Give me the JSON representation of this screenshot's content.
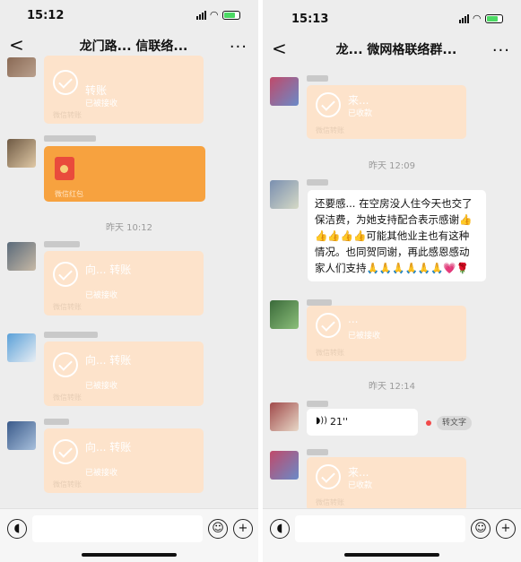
{
  "left": {
    "status": {
      "time": "15:12"
    },
    "nav": {
      "back": "<",
      "title": "龙门路... 信联络...",
      "more": "..."
    },
    "messages": [
      {
        "type": "transfer",
        "title": "转账",
        "status": "已被接收",
        "footer": "微信转账"
      },
      {
        "type": "redpacket",
        "title": "",
        "footer": "微信红包"
      },
      {
        "type": "timestamp",
        "text": "昨天 10:12"
      },
      {
        "type": "transfer",
        "title": "向... 转账",
        "status": "已被接收",
        "footer": "微信转账"
      },
      {
        "type": "transfer",
        "title": "向... 转账",
        "status": "已被接收",
        "footer": "微信转账"
      },
      {
        "type": "transfer",
        "title": "向... 转账",
        "status": "已被接收",
        "footer": "微信转账"
      }
    ]
  },
  "right": {
    "status": {
      "time": "15:13"
    },
    "nav": {
      "back": "<",
      "title": "龙... 微网格联络群...",
      "more": "..."
    },
    "messages": [
      {
        "type": "transfer",
        "title": "来...",
        "status": "已收款",
        "footer": "微信转账"
      },
      {
        "type": "timestamp",
        "text": "昨天 12:09"
      },
      {
        "type": "text",
        "text": "还要感... 在空房没人住今天也交了保洁费，为她支持配合表示感谢👍👍👍👍👍可能其他业主也有这种情况。也同贺同谢，再此感恩感动家人们支持🙏🙏🙏🙏🙏🙏💗🌹"
      },
      {
        "type": "transfer",
        "title": "...",
        "status": "已被接收",
        "footer": "微信转账"
      },
      {
        "type": "timestamp",
        "text": "昨天 12:14"
      },
      {
        "type": "voice",
        "duration": "21''",
        "to_text": "转文字"
      },
      {
        "type": "transfer",
        "title": "来...",
        "status": "已收款",
        "footer": "微信转账"
      }
    ]
  },
  "colors": {
    "transfer_bubble": "#fde3cb",
    "redpacket_bubble": "#f7a23f",
    "background": "#ededed"
  },
  "icons": [
    "back-icon",
    "more-icon",
    "voice-input-icon",
    "emoji-icon",
    "add-icon",
    "check-circle-icon",
    "red-envelope-icon",
    "voice-wave-icon"
  ]
}
